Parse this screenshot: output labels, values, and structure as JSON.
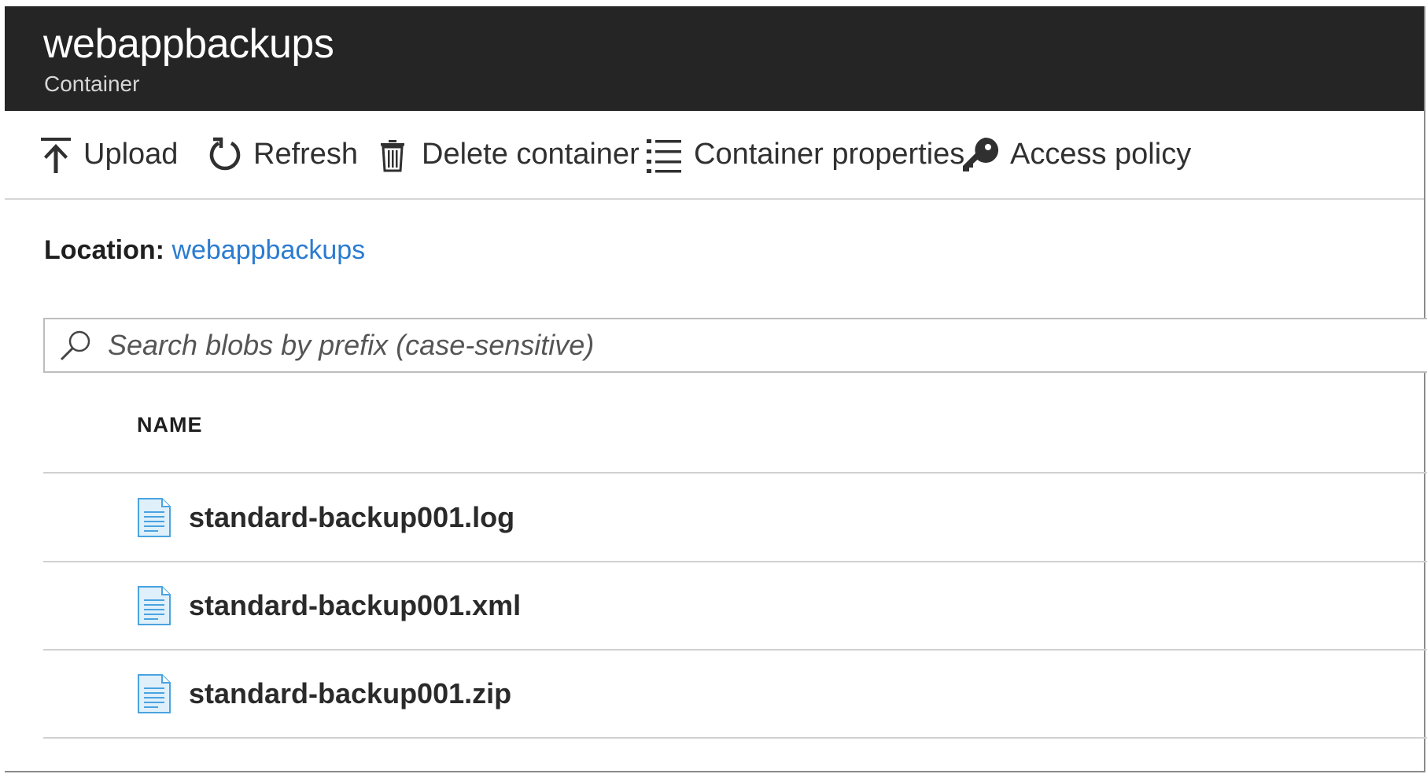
{
  "header": {
    "title": "webappbackups",
    "subtitle": "Container"
  },
  "toolbar": {
    "items": [
      {
        "label": "Upload",
        "icon": "upload-icon"
      },
      {
        "label": "Refresh",
        "icon": "refresh-icon"
      },
      {
        "label": "Delete container",
        "icon": "trash-icon"
      },
      {
        "label": "Container properties",
        "icon": "list-icon"
      },
      {
        "label": "Access policy",
        "icon": "key-icon"
      }
    ]
  },
  "location": {
    "label": "Location:",
    "link": "webappbackups"
  },
  "search": {
    "placeholder": "Search blobs by prefix (case-sensitive)",
    "value": ""
  },
  "table": {
    "columns": [
      "NAME"
    ],
    "rows": [
      {
        "name": "standard-backup001.log",
        "icon": "file-icon"
      },
      {
        "name": "standard-backup001.xml",
        "icon": "file-icon"
      },
      {
        "name": "standard-backup001.zip",
        "icon": "file-icon"
      }
    ]
  },
  "colors": {
    "header_bg": "#252525",
    "link": "#2b7bd1",
    "file_icon": "#4aa3df"
  }
}
